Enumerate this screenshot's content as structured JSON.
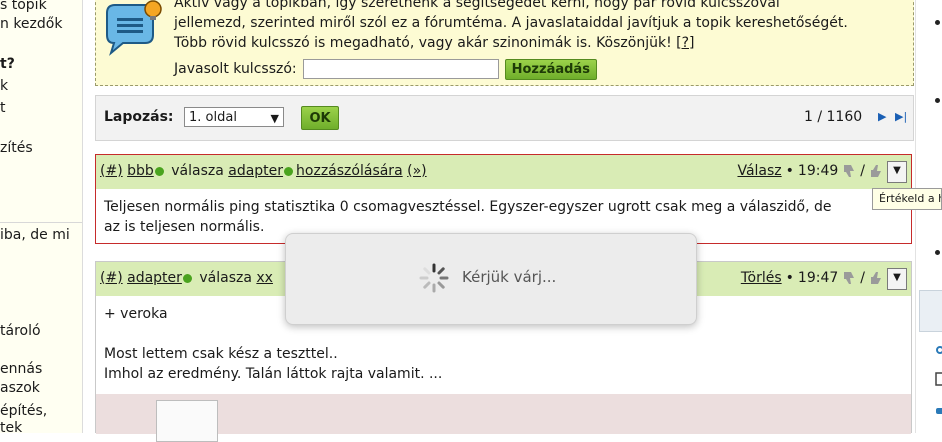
{
  "sidebar": {
    "items": [
      {
        "text": "s topik",
        "bold": false
      },
      {
        "text": "n kezdők",
        "bold": false
      },
      {
        "text": "t?",
        "bold": true
      },
      {
        "text": "k",
        "bold": false
      },
      {
        "text": "t",
        "bold": false
      },
      {
        "text": "zítés",
        "bold": false
      },
      {
        "text": "iba, de mi",
        "bold": false
      },
      {
        "text": "tároló",
        "bold": false
      },
      {
        "text": "ennás",
        "bold": false
      },
      {
        "text": "aszok",
        "bold": false
      },
      {
        "text": "építés,",
        "bold": false
      },
      {
        "text": "tek",
        "bold": false
      }
    ]
  },
  "keyword_box": {
    "line1": "Aktív vagy a topikban, így szeretnénk a segítségedet kérni, hogy pár rövid kulcsszóval",
    "line2": "jellemezd, szerinted miről szól ez a fórumtéma. A javaslataiddal javítjuk a topik kereshetőségét.",
    "line3": "Több rövid kulcsszó is megadható, vagy akár szinonimák is. Köszönjük!",
    "help_link": "[?]",
    "input_label": "Javasolt kulcsszó:",
    "input_value": "",
    "add_button": "Hozzáadás"
  },
  "pager": {
    "label": "Lapozás:",
    "selected_page": "1. oldal",
    "ok_button": "OK",
    "counter": "1 / 1160",
    "next_icon": "▶",
    "last_icon": "▶|"
  },
  "posts": [
    {
      "id_link": "(#)",
      "author": "bbb",
      "reply_word": "válasza",
      "target_user": "adapter",
      "target_suffix": "hozzászólására",
      "context_link": "(»)",
      "action": "Válasz",
      "time": "19:49",
      "body": [
        "Teljesen normális ping statisztika 0 csomagvesztéssel. Egyszer-egyszer ugrott csak meg a válaszidő, de",
        "az is teljesen normális."
      ]
    },
    {
      "id_link": "(#)",
      "author": "adapter",
      "reply_word": "válasza",
      "target_user": "xx",
      "action": "Törlés",
      "time": "19:47",
      "body": [
        "+ veroka",
        "",
        "Most lettem csak kész a teszttel..",
        "Imhol az eredmény. Talán láttok rajta valamit. ..."
      ]
    }
  ],
  "tooltip": {
    "text": "Értékeld a h"
  },
  "loading": {
    "text": "Kérjük várj..."
  },
  "colors": {
    "keyword_bg": "#fdfbd3",
    "post_header_bg": "#d9ecb5",
    "online_dot": "#4aa31e",
    "button_green": "#7cbf33",
    "highlight_border": "#c62b2b"
  }
}
